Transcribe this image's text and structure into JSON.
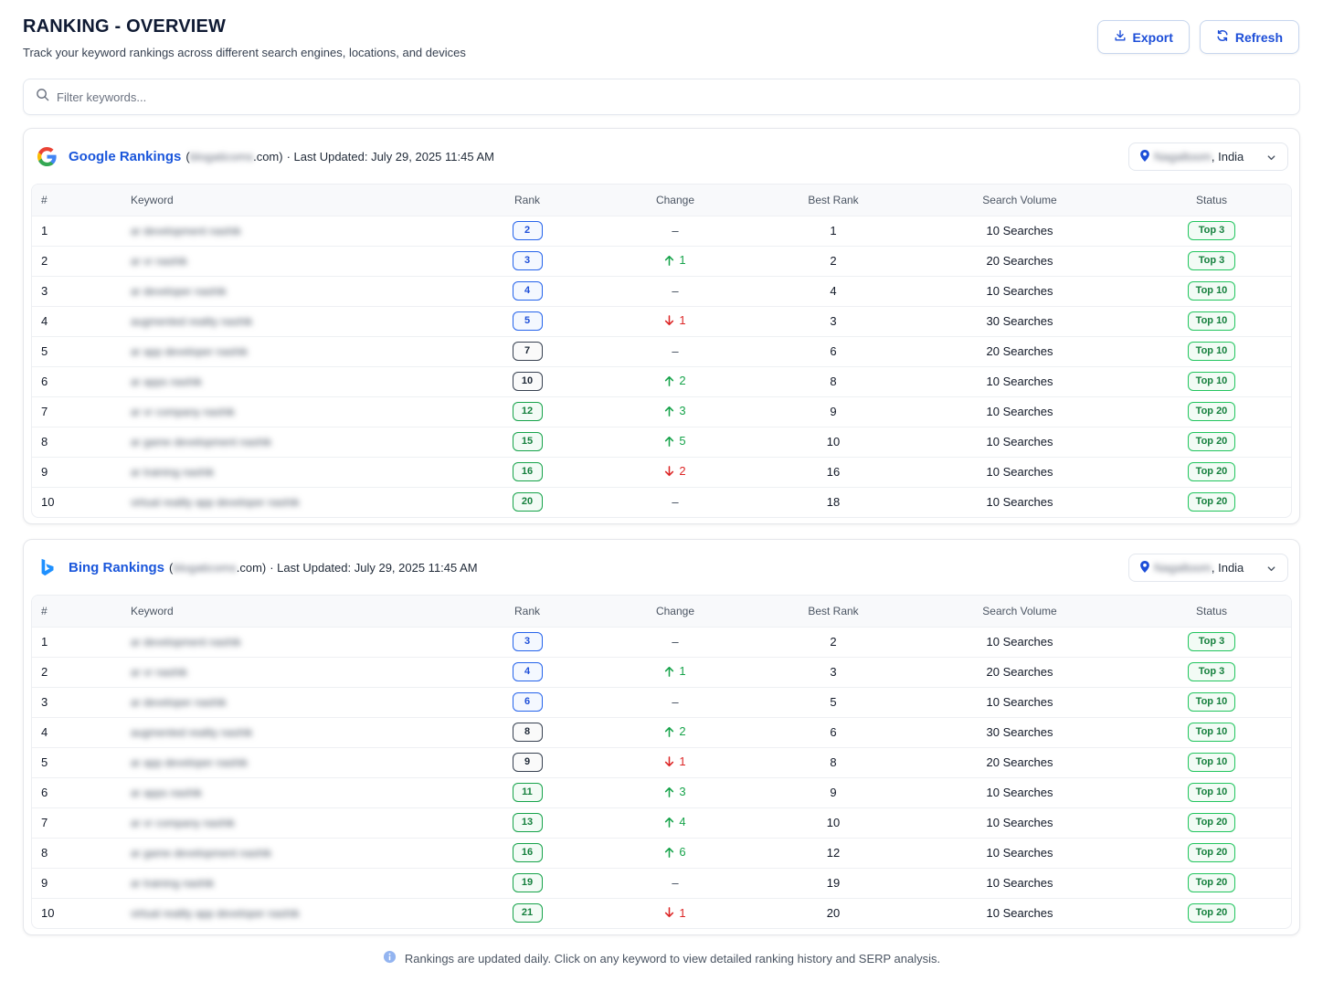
{
  "page": {
    "title": "RANKING - OVERVIEW",
    "subtitle": "Track your keyword rankings across different search engines, locations, and devices"
  },
  "actions": {
    "export_label": "Export",
    "refresh_label": "Refresh"
  },
  "search": {
    "placeholder": "Filter keywords..."
  },
  "columns": {
    "num": "#",
    "keyword": "Keyword",
    "rank": "Rank",
    "change": "Change",
    "best_rank": "Best Rank",
    "volume": "Search Volume",
    "status": "Status"
  },
  "colors": {
    "accent": "#1a56db",
    "up": "#16a34a",
    "down": "#dc2626",
    "status_green": "#22c55e"
  },
  "cards": [
    {
      "engine": "Google Rankings",
      "icon": "google-logo-icon",
      "domain_hidden": "blogaticoms",
      "domain_suffix": ".com)",
      "meta": "· Last Updated: July 29, 2025 11:45 AM",
      "location_hidden": "Nagaltoom",
      "location_country": ", India",
      "rows": [
        {
          "n": "1",
          "kw": "ar development nashik",
          "rank": "2",
          "rank_style": "blue",
          "dir": "none",
          "chg": "–",
          "best": "1",
          "vol": "10 Searches",
          "status": "Top 3"
        },
        {
          "n": "2",
          "kw": "ar vr nashik",
          "rank": "3",
          "rank_style": "blue",
          "dir": "up",
          "chg": "1",
          "best": "2",
          "vol": "20 Searches",
          "status": "Top 3"
        },
        {
          "n": "3",
          "kw": "ar developer nashik",
          "rank": "4",
          "rank_style": "blue",
          "dir": "none",
          "chg": "–",
          "best": "4",
          "vol": "10 Searches",
          "status": "Top 10"
        },
        {
          "n": "4",
          "kw": "augmented reality nashik",
          "rank": "5",
          "rank_style": "blue",
          "dir": "down",
          "chg": "1",
          "best": "3",
          "vol": "30 Searches",
          "status": "Top 10"
        },
        {
          "n": "5",
          "kw": "ar app developer nashik",
          "rank": "7",
          "rank_style": "dark",
          "dir": "none",
          "chg": "–",
          "best": "6",
          "vol": "20 Searches",
          "status": "Top 10"
        },
        {
          "n": "6",
          "kw": "ar apps nashik",
          "rank": "10",
          "rank_style": "dark",
          "dir": "up",
          "chg": "2",
          "best": "8",
          "vol": "10 Searches",
          "status": "Top 10"
        },
        {
          "n": "7",
          "kw": "ar vr company nashik",
          "rank": "12",
          "rank_style": "green",
          "dir": "up",
          "chg": "3",
          "best": "9",
          "vol": "10 Searches",
          "status": "Top 20"
        },
        {
          "n": "8",
          "kw": "ar game development nashik",
          "rank": "15",
          "rank_style": "green",
          "dir": "up",
          "chg": "5",
          "best": "10",
          "vol": "10 Searches",
          "status": "Top 20"
        },
        {
          "n": "9",
          "kw": "ar training nashik",
          "rank": "16",
          "rank_style": "green",
          "dir": "down",
          "chg": "2",
          "best": "16",
          "vol": "10 Searches",
          "status": "Top 20"
        },
        {
          "n": "10",
          "kw": "virtual reality app developer nashik",
          "rank": "20",
          "rank_style": "green",
          "dir": "none",
          "chg": "–",
          "best": "18",
          "vol": "10 Searches",
          "status": "Top 20"
        }
      ]
    },
    {
      "engine": "Bing Rankings",
      "icon": "bing-logo-icon",
      "domain_hidden": "blogaticoms",
      "domain_suffix": ".com)",
      "meta": "· Last Updated: July 29, 2025 11:45 AM",
      "location_hidden": "Nagaltoom",
      "location_country": ", India",
      "rows": [
        {
          "n": "1",
          "kw": "ar development nashik",
          "rank": "3",
          "rank_style": "blue",
          "dir": "none",
          "chg": "–",
          "best": "2",
          "vol": "10 Searches",
          "status": "Top 3"
        },
        {
          "n": "2",
          "kw": "ar vr nashik",
          "rank": "4",
          "rank_style": "blue",
          "dir": "up",
          "chg": "1",
          "best": "3",
          "vol": "20 Searches",
          "status": "Top 3"
        },
        {
          "n": "3",
          "kw": "ar developer nashik",
          "rank": "6",
          "rank_style": "blue",
          "dir": "none",
          "chg": "–",
          "best": "5",
          "vol": "10 Searches",
          "status": "Top 10"
        },
        {
          "n": "4",
          "kw": "augmented reality nashik",
          "rank": "8",
          "rank_style": "dark",
          "dir": "up",
          "chg": "2",
          "best": "6",
          "vol": "30 Searches",
          "status": "Top 10"
        },
        {
          "n": "5",
          "kw": "ar app developer nashik",
          "rank": "9",
          "rank_style": "dark",
          "dir": "down",
          "chg": "1",
          "best": "8",
          "vol": "20 Searches",
          "status": "Top 10"
        },
        {
          "n": "6",
          "kw": "ar apps nashik",
          "rank": "11",
          "rank_style": "green",
          "dir": "up",
          "chg": "3",
          "best": "9",
          "vol": "10 Searches",
          "status": "Top 10"
        },
        {
          "n": "7",
          "kw": "ar vr company nashik",
          "rank": "13",
          "rank_style": "green",
          "dir": "up",
          "chg": "4",
          "best": "10",
          "vol": "10 Searches",
          "status": "Top 20"
        },
        {
          "n": "8",
          "kw": "ar game development nashik",
          "rank": "16",
          "rank_style": "green",
          "dir": "up",
          "chg": "6",
          "best": "12",
          "vol": "10 Searches",
          "status": "Top 20"
        },
        {
          "n": "9",
          "kw": "ar training nashik",
          "rank": "19",
          "rank_style": "green",
          "dir": "none",
          "chg": "–",
          "best": "19",
          "vol": "10 Searches",
          "status": "Top 20"
        },
        {
          "n": "10",
          "kw": "virtual reality app developer nashik",
          "rank": "21",
          "rank_style": "green",
          "dir": "down",
          "chg": "1",
          "best": "20",
          "vol": "10 Searches",
          "status": "Top 20"
        }
      ]
    }
  ],
  "footer": {
    "note": "Rankings are updated daily. Click on any keyword to view detailed ranking history and SERP analysis."
  }
}
